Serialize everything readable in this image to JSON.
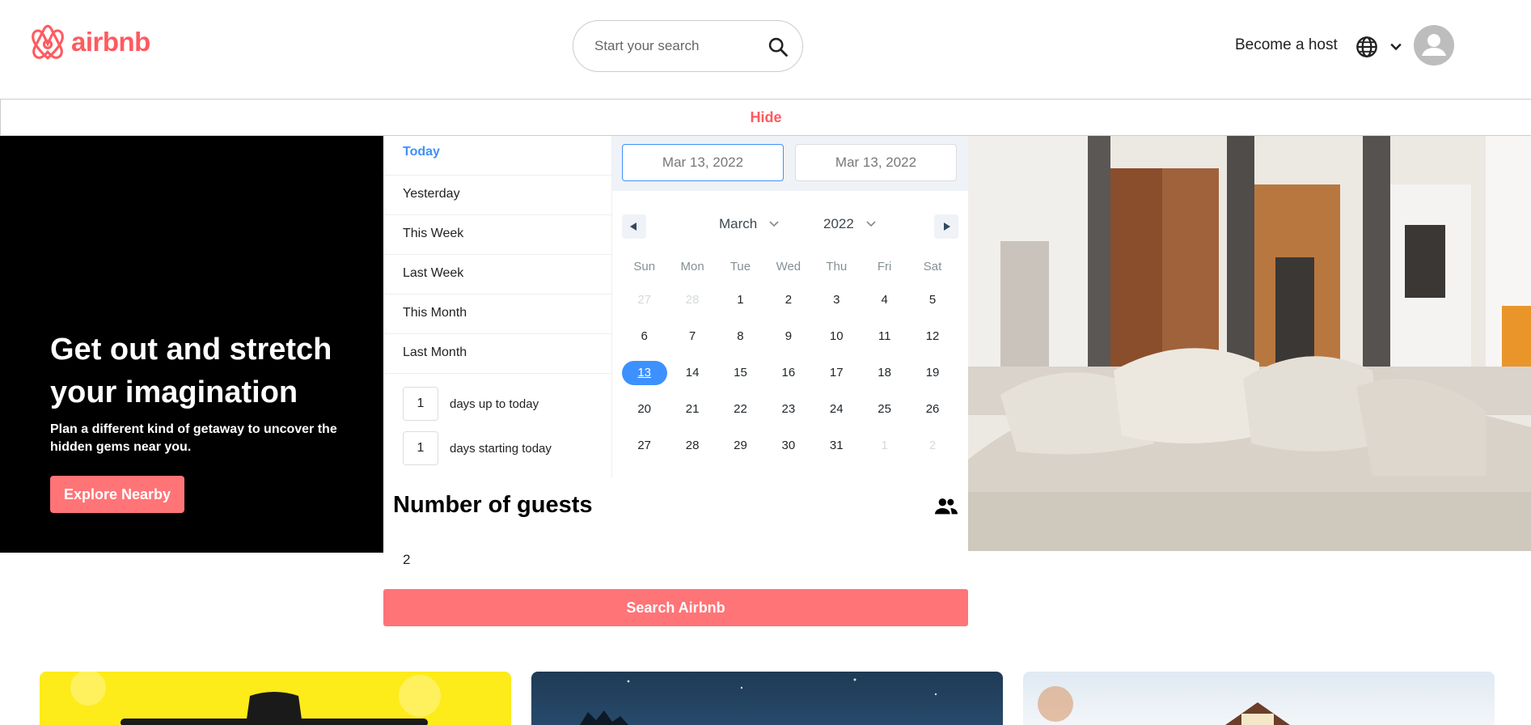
{
  "header": {
    "logo_text": "airbnb",
    "search_placeholder": "Start your search",
    "become_host": "Become a host"
  },
  "hide_label": "Hide",
  "hero": {
    "title": "Get out and stretch your imagination",
    "subtitle": "Plan a different kind of getaway to uncover the hidden gems near you.",
    "explore_button": "Explore Nearby"
  },
  "date_picker": {
    "static_ranges": [
      "Today",
      "Yesterday",
      "This Week",
      "Last Week",
      "This Month",
      "Last Month"
    ],
    "active_range": "Today",
    "input_ranges": [
      {
        "value": "1",
        "label": "days up to today"
      },
      {
        "value": "1",
        "label": "days starting today"
      }
    ],
    "start_date": "Mar 13, 2022",
    "end_date": "Mar 13, 2022",
    "month": "March",
    "year": "2022",
    "weekdays": [
      "Sun",
      "Mon",
      "Tue",
      "Wed",
      "Thu",
      "Fri",
      "Sat"
    ],
    "weeks": [
      [
        "27",
        "28",
        "1",
        "2",
        "3",
        "4",
        "5"
      ],
      [
        "6",
        "7",
        "8",
        "9",
        "10",
        "11",
        "12"
      ],
      [
        "13",
        "14",
        "15",
        "16",
        "17",
        "18",
        "19"
      ],
      [
        "20",
        "21",
        "22",
        "23",
        "24",
        "25",
        "26"
      ],
      [
        "27",
        "28",
        "29",
        "30",
        "31",
        "1",
        "2"
      ]
    ],
    "selected_day": "13",
    "accent_color": "#3d91ff"
  },
  "guests": {
    "title": "Number of guests",
    "value": "2"
  },
  "search_button": "Search Airbnb",
  "colors": {
    "brand": "#ff5a5f",
    "button": "#ff7477"
  }
}
